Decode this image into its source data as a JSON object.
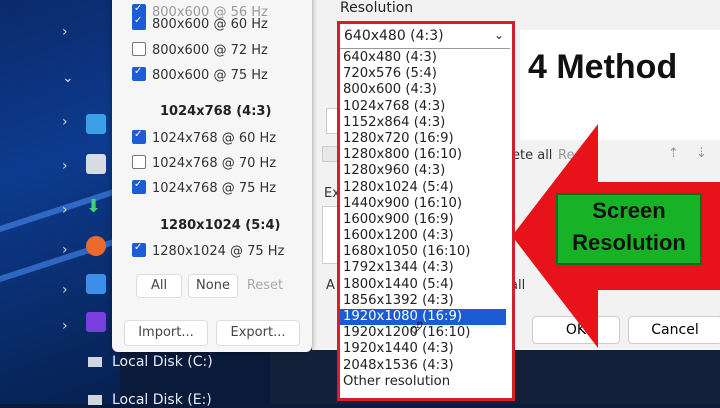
{
  "explorer": {
    "drives": [
      "Local Disk (C:)",
      "Local Disk (E:)"
    ]
  },
  "modes": {
    "items_top": [
      {
        "label": "800x600 @ 60 Hz",
        "checked": true
      },
      {
        "label": "800x600 @ 72 Hz",
        "checked": false
      },
      {
        "label": "800x600 @ 75 Hz",
        "checked": true
      }
    ],
    "group_1024": "1024x768 (4:3)",
    "items_1024": [
      {
        "label": "1024x768 @ 60 Hz",
        "checked": true
      },
      {
        "label": "1024x768 @ 70 Hz",
        "checked": false
      },
      {
        "label": "1024x768 @ 75 Hz",
        "checked": true
      }
    ],
    "group_1280": "1280x1024 (5:4)",
    "items_1280": [
      {
        "label": "1280x1024 @ 75 Hz",
        "checked": true
      }
    ],
    "all_label": "All",
    "none_label": "None",
    "reset_label": "Reset",
    "import_label": "Import...",
    "export_label": "Export..."
  },
  "resolution": {
    "label": "Resolution",
    "selected": "640x480 (4:3)",
    "options": [
      "640x480 (4:3)",
      "720x576 (5:4)",
      "800x600 (4:3)",
      "1024x768 (4:3)",
      "1152x864 (4:3)",
      "1280x720 (16:9)",
      "1280x800 (16:10)",
      "1280x960 (4:3)",
      "1280x1024 (5:4)",
      "1440x900 (16:10)",
      "1600x900 (16:9)",
      "1600x1200 (4:3)",
      "1680x1050 (16:10)",
      "1792x1344 (4:3)",
      "1800x1440 (5:4)",
      "1856x1392 (4:3)",
      "1920x1080 (16:9)",
      "1920x1200 (16:10)",
      "1920x1440 (4:3)",
      "2048x1536 (4:3)",
      "Other resolution"
    ],
    "highlighted_index": 16
  },
  "background": {
    "method_title": "4 Method",
    "delete_all": "ete all",
    "reset_partial": "Re",
    "ex_label": "Ex",
    "ok_label": "OK",
    "cancel_label": "Cancel"
  },
  "annotation": {
    "line1": "Screen",
    "line2": "Resolution",
    "arrow_color": "#e8121a",
    "box_color": "#18b226"
  }
}
